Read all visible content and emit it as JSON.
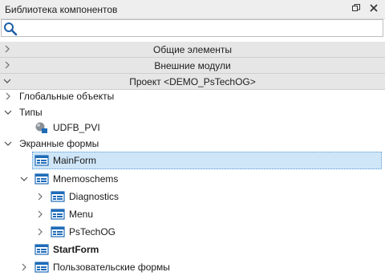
{
  "panel": {
    "title": "Библиотека компонентов",
    "pin_icon": "pin-icon",
    "close_icon": "close-icon"
  },
  "search": {
    "value": "",
    "placeholder": ""
  },
  "sections": {
    "common": "Общие элементы",
    "external": "Внешние модули",
    "project": "Проект <DEMO_PsTechOG>"
  },
  "tree": {
    "global_objects": "Глобальные объекты",
    "types": "Типы",
    "udfb": "UDFB_PVI",
    "screen_forms": "Экранные формы",
    "main_form": "MainForm",
    "mnemoschems": "Mnemoschems",
    "diagnostics": "Diagnostics",
    "menu": "Menu",
    "pstechog": "PsTechOG",
    "start_form": "StartForm",
    "user_forms": "Пользовательские формы"
  },
  "colors": {
    "selection": "#cfe6f8",
    "accent": "#1e6bb8",
    "section_bg": "#e6e6e6"
  }
}
